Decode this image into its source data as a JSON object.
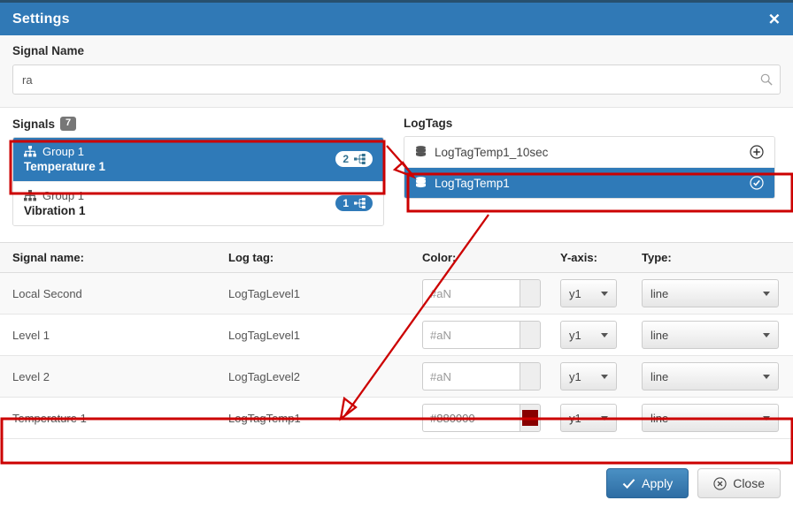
{
  "window": {
    "title": "Settings",
    "close_icon": "close-x-icon"
  },
  "search": {
    "label": "Signal Name",
    "value": "ra",
    "placeholder": "",
    "icon": "search-icon"
  },
  "signals_panel": {
    "title": "Signals",
    "count_badge": "7",
    "items": [
      {
        "group": "Group 1",
        "name": "Temperature 1",
        "badge_count": "2",
        "selected": true,
        "group_icon": "sitemap-icon",
        "badge_icon": "sitemap-icon"
      },
      {
        "group": "Group 1",
        "name": "Vibration 1",
        "badge_count": "1",
        "selected": false,
        "group_icon": "sitemap-icon",
        "badge_icon": "sitemap-icon"
      }
    ]
  },
  "logtags_panel": {
    "title": "LogTags",
    "items": [
      {
        "name": "LogTagTemp1_10sec",
        "selected": false,
        "left_icon": "database-icon",
        "action_icon": "plus-circle-icon"
      },
      {
        "name": "LogTagTemp1",
        "selected": true,
        "left_icon": "database-icon",
        "action_icon": "check-circle-icon"
      }
    ]
  },
  "table": {
    "columns": [
      "Signal name:",
      "Log tag:",
      "Color:",
      "Y-axis:",
      "Type:",
      ""
    ],
    "rows": [
      {
        "signal_name": "Local Second",
        "log_tag": "LogTagLevel1",
        "color_value": "#aN",
        "color_filled": false,
        "swatch": "",
        "y_axis": "y1",
        "type": "line",
        "delete_icon": "remove-circle-icon"
      },
      {
        "signal_name": "Level 1",
        "log_tag": "LogTagLevel1",
        "color_value": "#aN",
        "color_filled": false,
        "swatch": "",
        "y_axis": "y1",
        "type": "line",
        "delete_icon": "remove-circle-icon"
      },
      {
        "signal_name": "Level 2",
        "log_tag": "LogTagLevel2",
        "color_value": "#aN",
        "color_filled": false,
        "swatch": "",
        "y_axis": "y1",
        "type": "line",
        "delete_icon": "remove-circle-icon"
      },
      {
        "signal_name": "Temperature 1",
        "log_tag": "LogTagTemp1",
        "color_value": "#880000",
        "color_filled": true,
        "swatch": "#880000",
        "y_axis": "y1",
        "type": "line",
        "delete_icon": "remove-circle-icon"
      }
    ]
  },
  "footer": {
    "apply_label": "Apply",
    "apply_icon": "check-icon",
    "close_label": "Close",
    "close_icon": "remove-circle-icon"
  },
  "annotations": {
    "color": "#cc0000",
    "highlight_boxes": [
      "signals-selected-row",
      "logtags-selected-row",
      "table-temperature-row"
    ],
    "arrows": [
      "signal-to-logtag-arrow",
      "logtag-to-table-row-arrow"
    ]
  },
  "colors": {
    "header_blue": "#3079b6",
    "selection_blue": "#2f7ab8",
    "annotation_red": "#cc0000",
    "danger_red": "#c9302c",
    "swatch_dark_red": "#880000"
  }
}
